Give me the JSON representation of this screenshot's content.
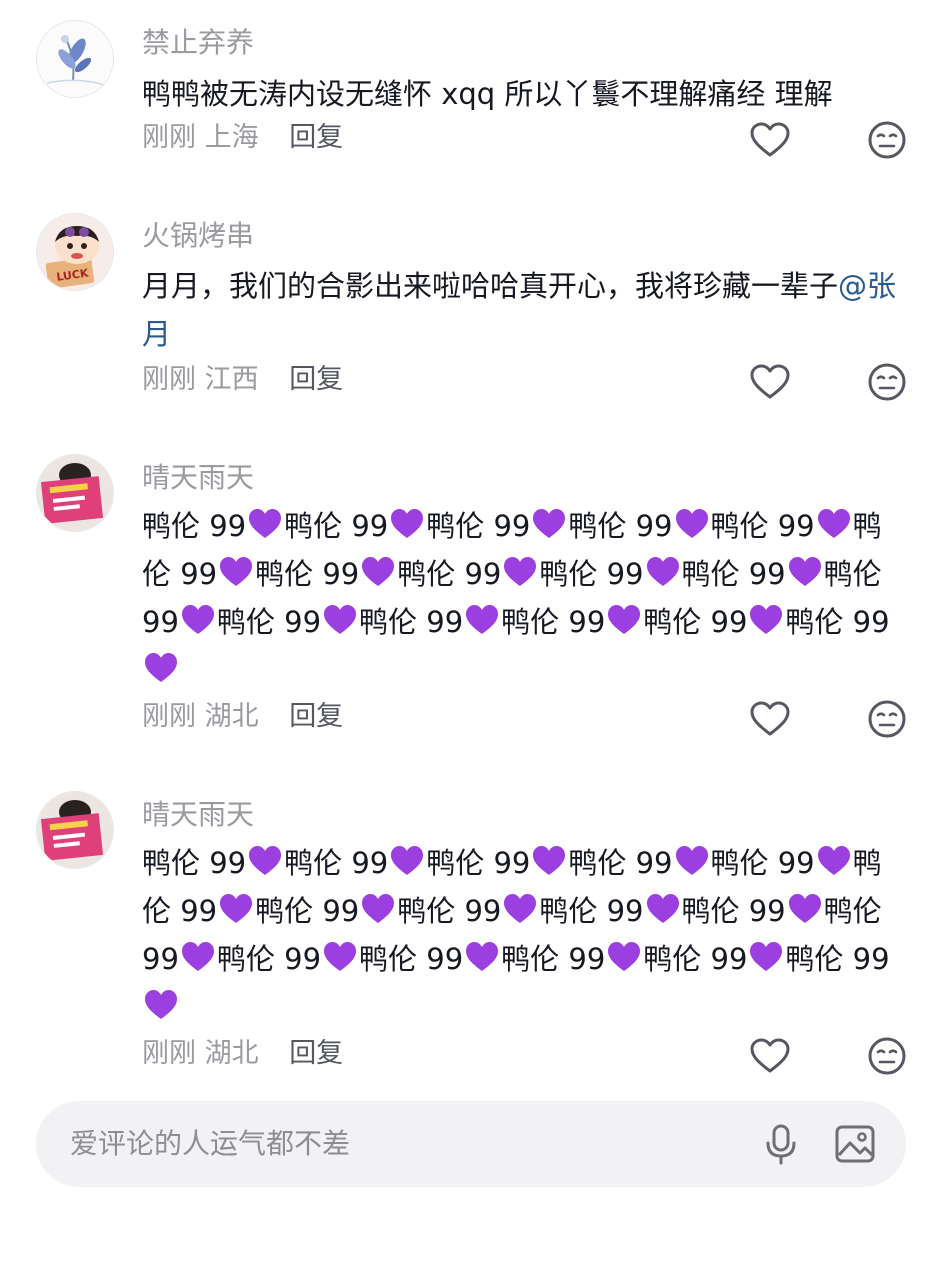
{
  "comments": [
    {
      "username": "禁止弃养",
      "content": "鸭鸭被无涛内设无缝怀 xqq 所以丫鬟不理解痛经 理解",
      "time": "刚刚",
      "location": "上海",
      "reply_label": "回复",
      "avatar_icon": "flower-avatar"
    },
    {
      "username": "火锅烤串",
      "content": "月月，我们的合影出来啦哈哈真开心，我将珍藏一辈子",
      "mention": "@张月",
      "time": "刚刚",
      "location": "江西",
      "reply_label": "回复",
      "avatar_icon": "cartoon-luck-avatar",
      "avatar_text": "LUCK"
    },
    {
      "username": "晴天雨天",
      "content_unit": "鸭伦 99",
      "content_repeat": 16,
      "emoji": "purple-heart",
      "time": "刚刚",
      "location": "湖北",
      "reply_label": "回复",
      "avatar_icon": "reading-book-avatar"
    },
    {
      "username": "晴天雨天",
      "content_unit": "鸭伦 99",
      "content_repeat": 16,
      "emoji": "purple-heart",
      "time": "刚刚",
      "location": "湖北",
      "reply_label": "回复",
      "avatar_icon": "reading-book-avatar"
    }
  ],
  "input": {
    "placeholder": "爱评论的人运气都不差",
    "mic_icon": "microphone-icon",
    "image_icon": "image-icon"
  },
  "colors": {
    "username": "#9a9aa0",
    "text": "#161823",
    "mention": "#2b5a8f",
    "purple_heart": "#9b3fe0",
    "input_bg": "#f2f2f4"
  }
}
